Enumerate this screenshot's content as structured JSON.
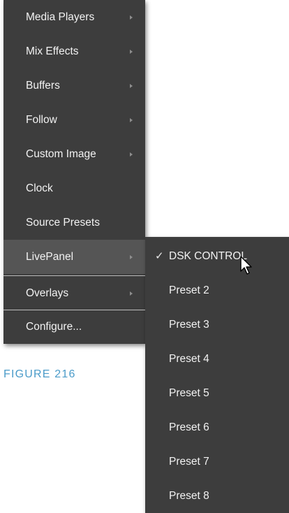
{
  "main_menu": {
    "items": [
      {
        "label": "Media Players",
        "submenu": true
      },
      {
        "label": "Mix Effects",
        "submenu": true
      },
      {
        "label": "Buffers",
        "submenu": true
      },
      {
        "label": "Follow",
        "submenu": true
      },
      {
        "label": "Custom Image",
        "submenu": true
      },
      {
        "label": "Clock",
        "submenu": false
      },
      {
        "label": "Source Presets",
        "submenu": false
      },
      {
        "label": "LivePanel",
        "submenu": true,
        "active": true
      },
      {
        "label": "Overlays",
        "submenu": true
      },
      {
        "label": "Configure...",
        "submenu": false
      }
    ]
  },
  "sub_menu": {
    "items": [
      {
        "label": "DSK CONTROL",
        "checked": true
      },
      {
        "label": "Preset 2"
      },
      {
        "label": "Preset 3"
      },
      {
        "label": "Preset 4"
      },
      {
        "label": "Preset 5"
      },
      {
        "label": "Preset 6"
      },
      {
        "label": "Preset 7"
      },
      {
        "label": "Preset 8"
      }
    ]
  },
  "caption": "FIGURE 216",
  "icons": {
    "checkmark": "✓",
    "submenu_arrow": "arrow-right-icon",
    "cursor": "mouse-pointer-icon"
  },
  "colors": {
    "menu_background": "#3d3d3d",
    "active_item": "#555555",
    "text": "#f2f2f2",
    "caption": "#4a9bc9"
  }
}
